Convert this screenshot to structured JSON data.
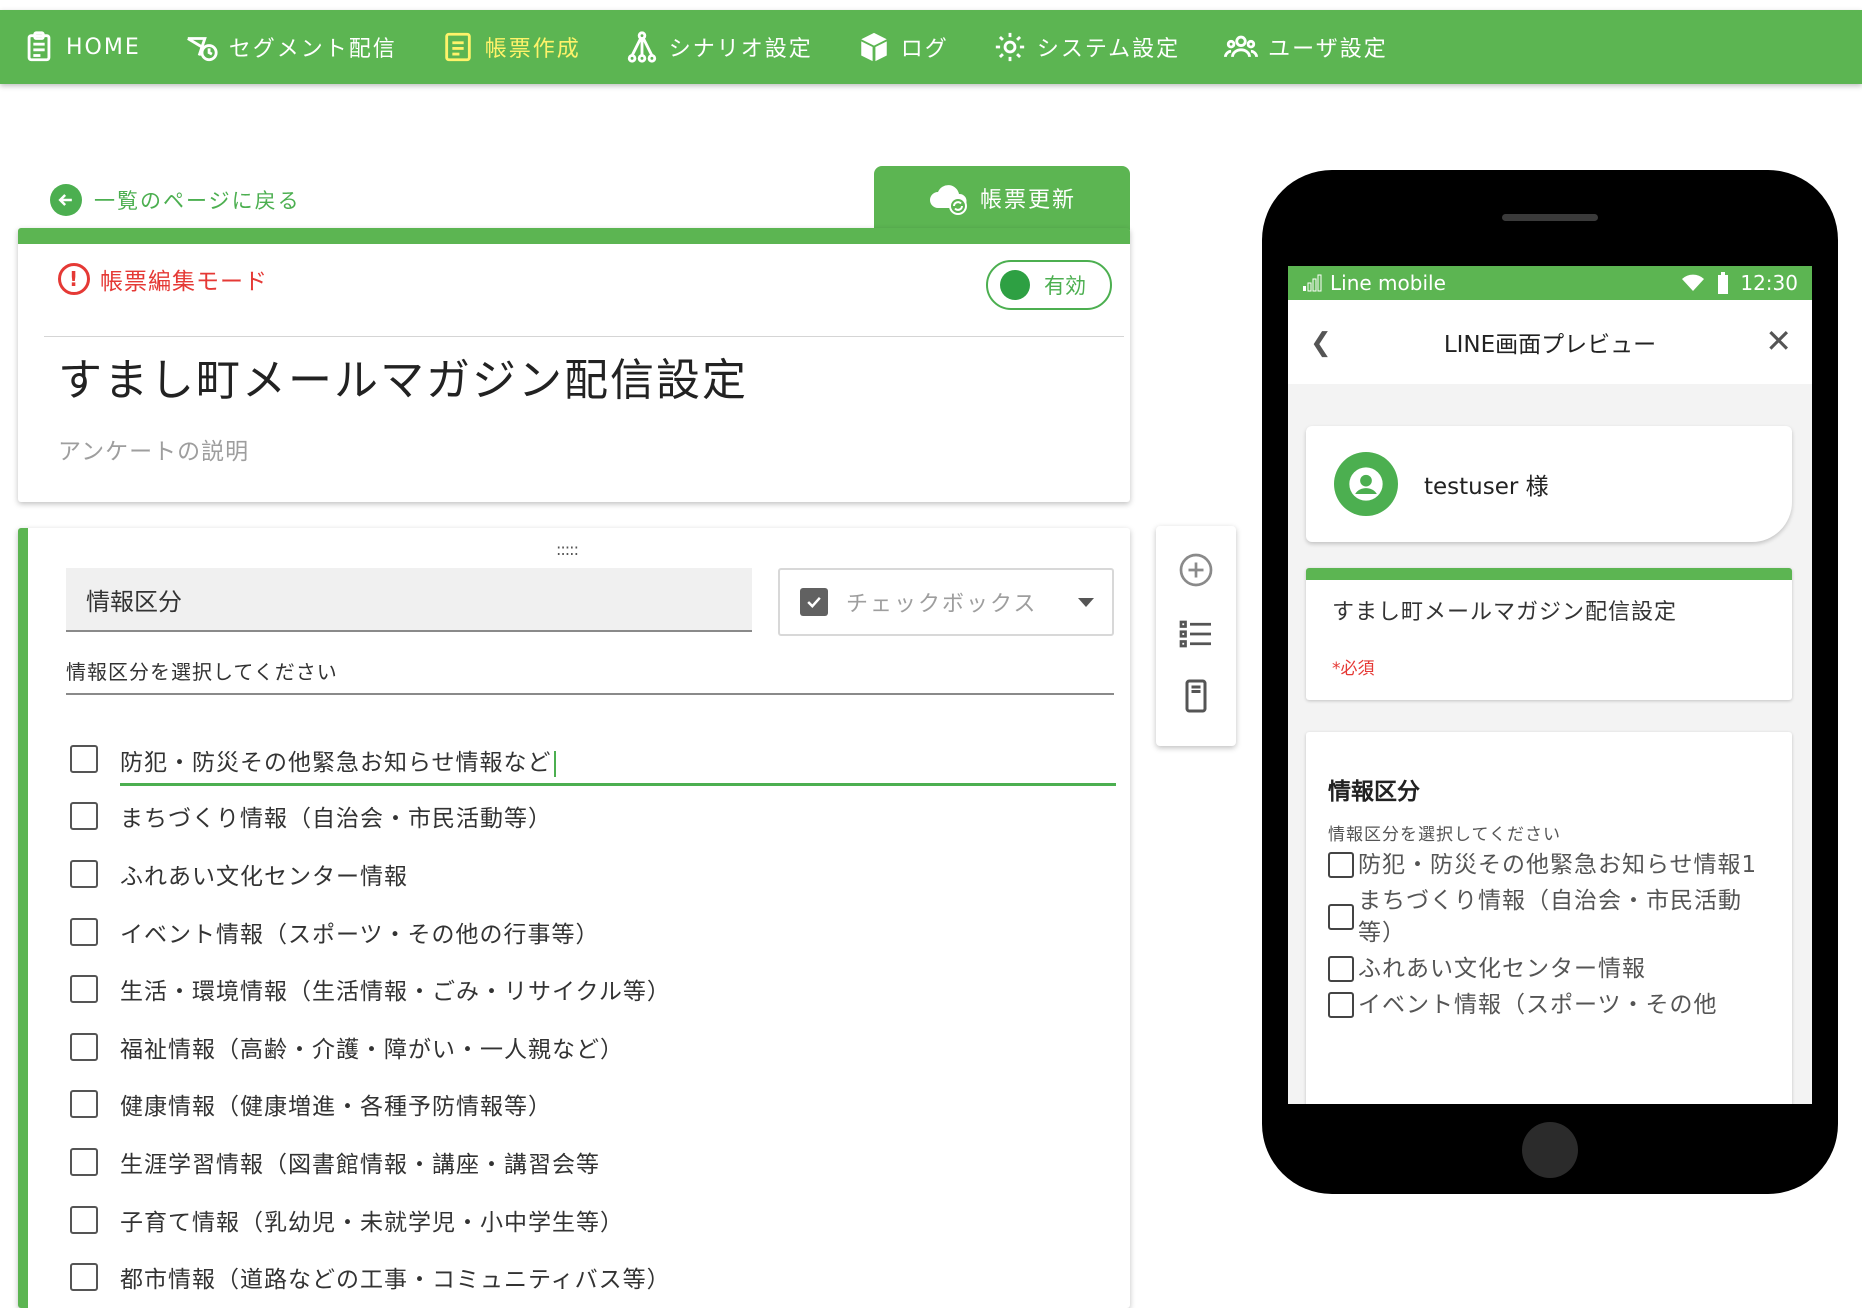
{
  "nav": {
    "items": [
      {
        "label": "HOME",
        "icon": "clipboard-icon",
        "active": false
      },
      {
        "label": "セグメント配信",
        "icon": "segment-delivery-icon",
        "active": false
      },
      {
        "label": "帳票作成",
        "icon": "form-icon",
        "active": true
      },
      {
        "label": "シナリオ設定",
        "icon": "scenario-icon",
        "active": false
      },
      {
        "label": "ログ",
        "icon": "box-icon",
        "active": false
      },
      {
        "label": "システム設定",
        "icon": "gear-icon",
        "active": false
      },
      {
        "label": "ユーザ設定",
        "icon": "users-icon",
        "active": false
      }
    ]
  },
  "back_link": "一覧のページに戻る",
  "update_button": "帳票更新",
  "form": {
    "mode_label": "帳票編集モード",
    "toggle_label": "有効",
    "title": "すまし町メールマガジン配信設定",
    "description_placeholder": "アンケートの説明"
  },
  "question": {
    "drag_handle": ":::::",
    "title": "情報区分",
    "type": "チェックボックス",
    "description": "情報区分を選択してください",
    "options": [
      "防犯・防災その他緊急お知らせ情報など",
      "まちづくり情報（自治会・市民活動等）",
      "ふれあい文化センター情報",
      "イベント情報（スポーツ・その他の行事等）",
      "生活・環境情報（生活情報・ごみ・リサイクル等）",
      "福祉情報（高齢・介護・障がい・一人親など）",
      "健康情報（健康増進・各種予防情報等）",
      "生涯学習情報（図書館情報・講座・講習会等",
      "子育て情報（乳幼児・未就学児・小中学生等）",
      "都市情報（道路などの工事・コミュニティバス等）"
    ]
  },
  "preview": {
    "carrier": "Line mobile",
    "time": "12:30",
    "header_title": "LINE画面プレビュー",
    "user": "testuser 様",
    "form_title": "すまし町メールマガジン配信設定",
    "required": "*必須",
    "question_title": "情報区分",
    "question_desc": "情報区分を選択してください",
    "options": [
      "防犯・防災その他緊急お知らせ情報1",
      "まちづくり情報（自治会・市民活動等）",
      "ふれあい文化センター情報",
      "イベント情報（スポーツ・その他"
    ]
  },
  "colors": {
    "primary": "#5cb552",
    "active_nav": "#fff36a",
    "error": "#e53935"
  }
}
